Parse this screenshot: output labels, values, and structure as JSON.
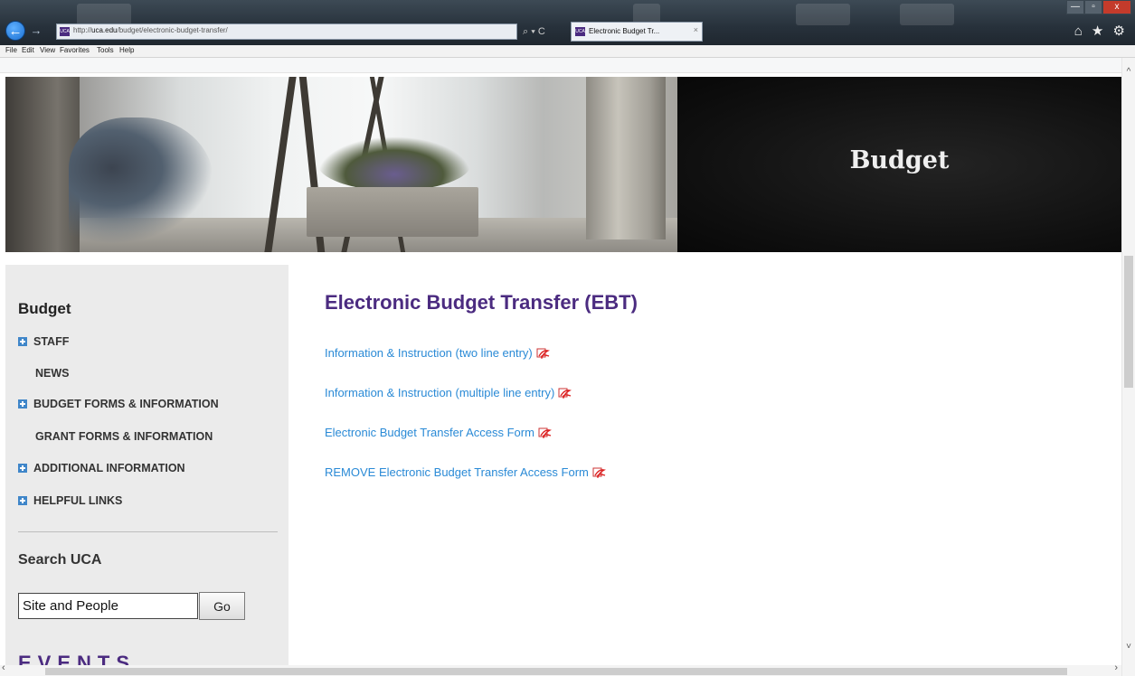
{
  "browser": {
    "url_prefix": "http://",
    "url_host": "uca.edu",
    "url_path": "/budget/electronic-budget-transfer/",
    "favicon_label": "UCA",
    "tab_title": "Electronic Budget Tr...",
    "tab_close": "×",
    "back_icon": "←",
    "forward_icon": "→",
    "address_tools": "⌕ ▾ C",
    "window": {
      "minimize": "—",
      "maximize": "▫",
      "close": "x"
    },
    "toolbar_icons": "⌂ ★ ⚙"
  },
  "menu": [
    "File",
    "Edit",
    "View",
    "Favorites",
    "Tools",
    "Help"
  ],
  "banner": {
    "title": "Budget"
  },
  "sidebar": {
    "heading": "Budget",
    "items": [
      {
        "label": "STAFF",
        "expandable": true
      },
      {
        "label": "NEWS",
        "expandable": false
      },
      {
        "label": "BUDGET FORMS & INFORMATION",
        "expandable": true
      },
      {
        "label": "GRANT FORMS & INFORMATION",
        "expandable": false
      },
      {
        "label": "ADDITIONAL INFORMATION",
        "expandable": true
      },
      {
        "label": "HELPFUL LINKS",
        "expandable": true
      }
    ],
    "search_heading": "Search UCA",
    "search_value": "Site and People",
    "go_label": "Go",
    "events_heading": "EVENTS"
  },
  "main": {
    "title": "Electronic Budget Transfer (EBT)",
    "links": [
      "Information & Instruction (two line entry)",
      "Information & Instruction (multiple line entry)",
      "Electronic Budget Transfer Access Form",
      "REMOVE Electronic Budget Transfer Access Form"
    ]
  },
  "scrollbars": {
    "up": "^",
    "down": "˅",
    "left": "‹",
    "right": "›"
  },
  "colors": {
    "accent_purple": "#4b2b80",
    "link_blue": "#2a8ad6",
    "icon_blue": "#3f86c9"
  }
}
